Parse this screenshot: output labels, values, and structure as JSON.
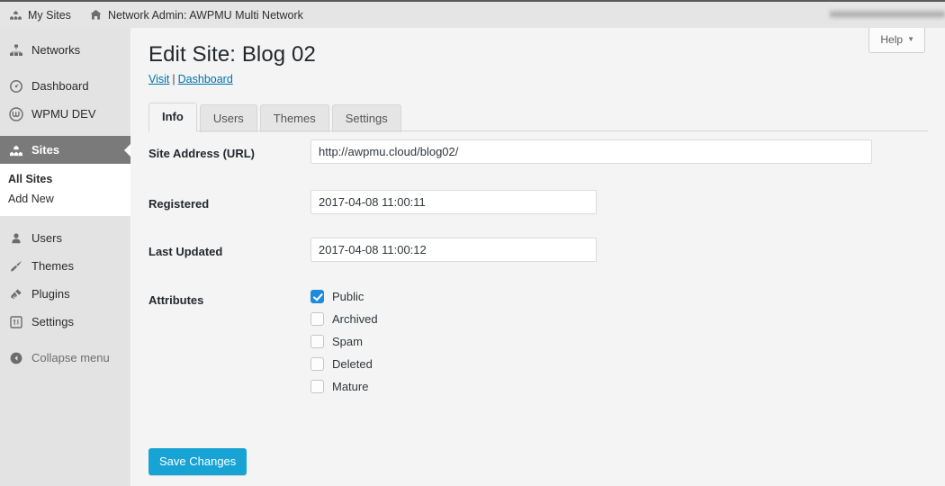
{
  "adminbar": {
    "my_sites": "My Sites",
    "my_sites_icon": "multisite-icon",
    "network_admin": "Network Admin: AWPMU Multi Network",
    "network_admin_icon": "home-icon",
    "account_area": "redacted-account-blur"
  },
  "sidebar": {
    "items": [
      {
        "label": "Networks",
        "icon": "network-icon",
        "active": false
      },
      {
        "label": "Dashboard",
        "icon": "gauge-icon",
        "active": false
      },
      {
        "label": "WPMU DEV",
        "icon": "wpmudev-icon",
        "active": false
      },
      {
        "label": "Sites",
        "icon": "sites-icon",
        "active": true
      },
      {
        "label": "Users",
        "icon": "user-icon",
        "active": false
      },
      {
        "label": "Themes",
        "icon": "brush-icon",
        "active": false
      },
      {
        "label": "Plugins",
        "icon": "plug-icon",
        "active": false
      },
      {
        "label": "Settings",
        "icon": "settings-icon",
        "active": false
      },
      {
        "label": "Collapse menu",
        "icon": "collapse-icon",
        "active": false
      }
    ],
    "submenu": [
      {
        "label": "All Sites",
        "current": true
      },
      {
        "label": "Add New",
        "current": false
      }
    ]
  },
  "help": {
    "label": "Help",
    "caret": "▼"
  },
  "page": {
    "title": "Edit Site: Blog 02",
    "links": {
      "visit": "Visit",
      "separator": "|",
      "dashboard": "Dashboard"
    }
  },
  "tabs": [
    {
      "label": "Info",
      "active": true
    },
    {
      "label": "Users",
      "active": false
    },
    {
      "label": "Themes",
      "active": false
    },
    {
      "label": "Settings",
      "active": false
    }
  ],
  "form": {
    "site_address": {
      "label": "Site Address (URL)",
      "value": "http://awpmu.cloud/blog02/"
    },
    "registered": {
      "label": "Registered",
      "value": "2017-04-08 11:00:11"
    },
    "last_updated": {
      "label": "Last Updated",
      "value": "2017-04-08 11:00:12"
    },
    "attributes": {
      "label": "Attributes",
      "options": [
        {
          "label": "Public",
          "checked": true
        },
        {
          "label": "Archived",
          "checked": false
        },
        {
          "label": "Spam",
          "checked": false
        },
        {
          "label": "Deleted",
          "checked": false
        },
        {
          "label": "Mature",
          "checked": false
        }
      ]
    },
    "save_label": "Save Changes"
  },
  "colors": {
    "admin_bar_bg": "#e5e5e5",
    "sidebar_bg": "#e3e3e3",
    "content_bg": "#f4f4f4",
    "active_menu_bg": "#7a7a7a",
    "link": "#0073aa",
    "checkbox_checked": "#1e8cde",
    "primary_button": "#17a3d4"
  }
}
